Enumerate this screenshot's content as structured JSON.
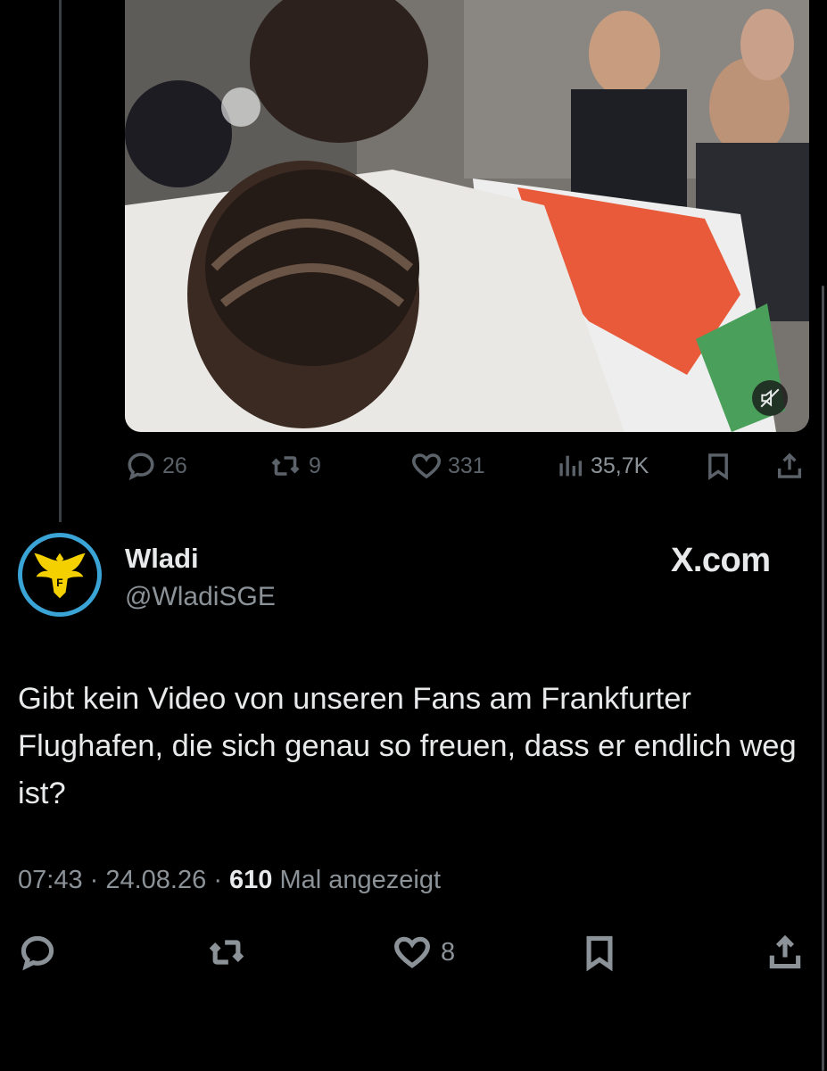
{
  "quoted": {
    "media_alt": "video",
    "stats": {
      "replies": "26",
      "retweets": "9",
      "likes": "331",
      "views": "35,7K"
    }
  },
  "author": {
    "name": "Wladi",
    "handle": "@WladiSGE"
  },
  "watermark": "X.com",
  "tweet": {
    "text": "Gibt kein Video von unseren Fans am Frankfurter Flughafen, die sich genau so freuen, dass er endlich weg ist?",
    "time": "07:43",
    "date": "24.08.26",
    "views": "610",
    "views_label": "Mal angezeigt",
    "likes": "8"
  },
  "colors": {
    "background": "#000000",
    "text": "#e7e9ea",
    "muted": "#8b9298",
    "avatar_ring": "#3aa4d6",
    "eagle": "#f5d000"
  },
  "icons": [
    "reply-icon",
    "retweet-icon",
    "like-icon",
    "views-icon",
    "bookmark-icon",
    "share-icon",
    "mute-icon",
    "eagle-logo"
  ]
}
